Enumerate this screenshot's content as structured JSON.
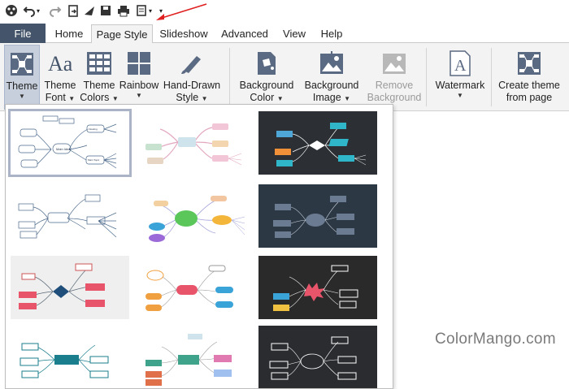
{
  "menu_tabs": {
    "file": "File",
    "home": "Home",
    "page_style": "Page Style",
    "slideshow": "Slideshow",
    "advanced": "Advanced",
    "view": "View",
    "help": "Help"
  },
  "quick_access": [
    "new-icon",
    "undo-icon",
    "redo-icon",
    "export-icon",
    "share-icon",
    "save-icon",
    "print-icon",
    "page-setup-icon",
    "customize-icon"
  ],
  "ribbon": {
    "theme": "Theme",
    "theme_font": [
      "Theme",
      "Font"
    ],
    "theme_colors": [
      "Theme",
      "Colors"
    ],
    "rainbow": "Rainbow",
    "hand_drawn": [
      "Hand-Drawn",
      "Style"
    ],
    "background_color": [
      "Background",
      "Color"
    ],
    "background_image": [
      "Background",
      "Image"
    ],
    "remove_background": [
      "Remove",
      "Background"
    ],
    "watermark": "Watermark",
    "create_theme": [
      "Create theme",
      "from page"
    ]
  },
  "gallery": {
    "main_idea": "Main Idea",
    "main_topic": "Main Topic",
    "floating": "Floating"
  },
  "watermark_text": {
    "color": "Color",
    "mango": "Mango",
    "com": ".com"
  },
  "colors": {
    "file_tab": "#44546a",
    "ribbon_bg": "#f3f3f3",
    "active_button": "#c7cfdd",
    "arrow": "#e02020"
  }
}
